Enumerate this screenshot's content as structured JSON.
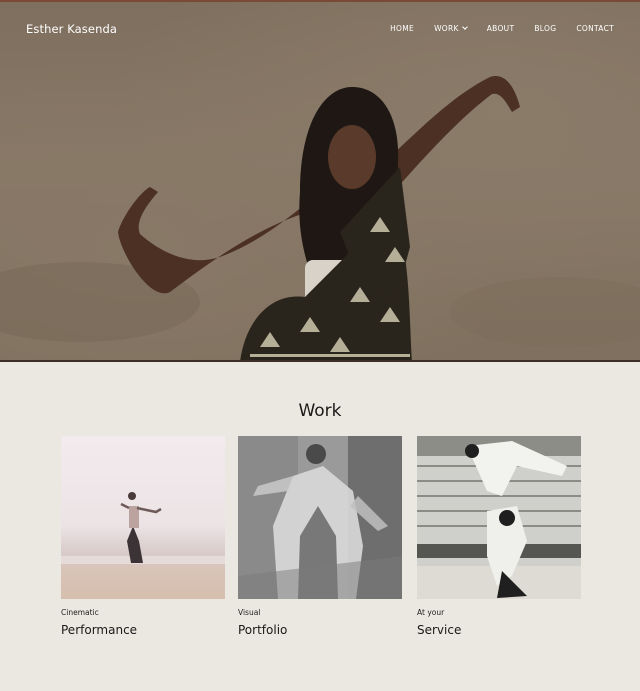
{
  "header": {
    "site_title": "Esther Kasenda",
    "nav": [
      {
        "label": "HOME"
      },
      {
        "label": "WORK",
        "has_dropdown": true
      },
      {
        "label": "ABOUT"
      },
      {
        "label": "BLOG"
      },
      {
        "label": "CONTACT"
      }
    ]
  },
  "work_section": {
    "heading": "Work",
    "cards": [
      {
        "kicker": "Cinematic",
        "title": "Performance"
      },
      {
        "kicker": "Visual",
        "title": "Portfolio"
      },
      {
        "kicker": "At your",
        "title": "Service"
      }
    ]
  },
  "colors": {
    "hero_sand": "#847463",
    "section_background": "#ebe8e2",
    "text_dark": "#1b1917",
    "nav_text": "#ffffff"
  }
}
